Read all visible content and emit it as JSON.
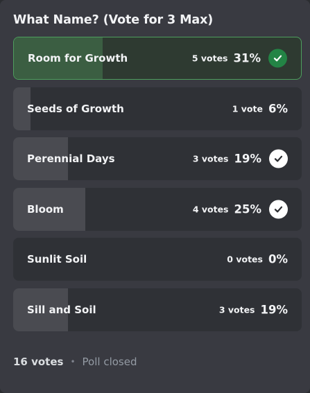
{
  "poll": {
    "question": "What Name? (Vote for 3 Max)",
    "options": [
      {
        "label": "Room for Growth",
        "votes": "5 votes",
        "percent": "31%",
        "share": 31,
        "voted": true,
        "user_choice": true
      },
      {
        "label": "Seeds of Growth",
        "votes": "1 vote",
        "percent": "6%",
        "share": 6,
        "voted": false,
        "user_choice": false
      },
      {
        "label": "Perennial Days",
        "votes": "3 votes",
        "percent": "19%",
        "share": 19,
        "voted": true,
        "user_choice": false
      },
      {
        "label": "Bloom",
        "votes": "4 votes",
        "percent": "25%",
        "share": 25,
        "voted": true,
        "user_choice": false
      },
      {
        "label": "Sunlit Soil",
        "votes": "0 votes",
        "percent": "0%",
        "share": 0,
        "voted": false,
        "user_choice": false
      },
      {
        "label": "Sill and Soil",
        "votes": "3 votes",
        "percent": "19%",
        "share": 19,
        "voted": false,
        "user_choice": false
      }
    ],
    "footer": {
      "total_votes": "16 votes",
      "separator": "•",
      "status": "Poll closed"
    }
  },
  "colors": {
    "card_background": "#393a41",
    "option_background": "#2f3136",
    "fill": "#4a4b51",
    "selected_border": "#4e9f5e",
    "selected_fill": "#3b5e42",
    "check_green": "#238445"
  },
  "icons": {
    "check": "checkmark-circle-icon"
  }
}
